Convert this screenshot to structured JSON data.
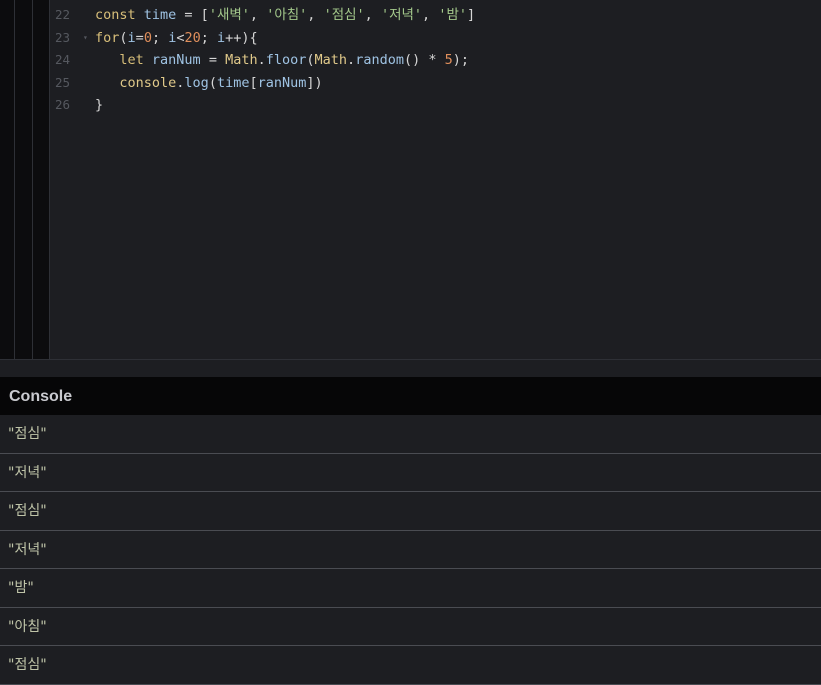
{
  "editor": {
    "lines": [
      {
        "number": "22",
        "fold": "",
        "tokens": [
          {
            "t": "const",
            "c": "kw"
          },
          {
            "t": " ",
            "c": "punct"
          },
          {
            "t": "time",
            "c": "var"
          },
          {
            "t": " = [",
            "c": "punct"
          },
          {
            "t": "'새벽'",
            "c": "str"
          },
          {
            "t": ", ",
            "c": "punct"
          },
          {
            "t": "'아침'",
            "c": "str"
          },
          {
            "t": ", ",
            "c": "punct"
          },
          {
            "t": "'점심'",
            "c": "str"
          },
          {
            "t": ", ",
            "c": "punct"
          },
          {
            "t": "'저녁'",
            "c": "str"
          },
          {
            "t": ", ",
            "c": "punct"
          },
          {
            "t": "'밤'",
            "c": "str"
          },
          {
            "t": "]",
            "c": "punct"
          }
        ]
      },
      {
        "number": "23",
        "fold": "▾",
        "tokens": [
          {
            "t": "for",
            "c": "kw"
          },
          {
            "t": "(",
            "c": "punct"
          },
          {
            "t": "i",
            "c": "var"
          },
          {
            "t": "=",
            "c": "punct"
          },
          {
            "t": "0",
            "c": "num"
          },
          {
            "t": "; ",
            "c": "punct"
          },
          {
            "t": "i",
            "c": "var"
          },
          {
            "t": "<",
            "c": "punct"
          },
          {
            "t": "20",
            "c": "num"
          },
          {
            "t": "; ",
            "c": "punct"
          },
          {
            "t": "i",
            "c": "var"
          },
          {
            "t": "++){",
            "c": "punct"
          }
        ]
      },
      {
        "number": "24",
        "fold": "",
        "tokens": [
          {
            "t": "   let",
            "c": "kw"
          },
          {
            "t": " ",
            "c": "punct"
          },
          {
            "t": "ranNum",
            "c": "var"
          },
          {
            "t": " = ",
            "c": "punct"
          },
          {
            "t": "Math",
            "c": "obj"
          },
          {
            "t": ".",
            "c": "punct"
          },
          {
            "t": "floor",
            "c": "fn"
          },
          {
            "t": "(",
            "c": "punct"
          },
          {
            "t": "Math",
            "c": "obj"
          },
          {
            "t": ".",
            "c": "punct"
          },
          {
            "t": "random",
            "c": "fn"
          },
          {
            "t": "() * ",
            "c": "punct"
          },
          {
            "t": "5",
            "c": "num"
          },
          {
            "t": ");",
            "c": "punct"
          }
        ]
      },
      {
        "number": "25",
        "fold": "",
        "tokens": [
          {
            "t": "   console",
            "c": "obj"
          },
          {
            "t": ".",
            "c": "punct"
          },
          {
            "t": "log",
            "c": "fn"
          },
          {
            "t": "(",
            "c": "punct"
          },
          {
            "t": "time",
            "c": "var"
          },
          {
            "t": "[",
            "c": "punct"
          },
          {
            "t": "ranNum",
            "c": "var"
          },
          {
            "t": "])",
            "c": "punct"
          }
        ]
      },
      {
        "number": "26",
        "fold": "",
        "tokens": [
          {
            "t": "}",
            "c": "punct"
          }
        ]
      }
    ]
  },
  "console": {
    "title": "Console",
    "entries": [
      "\"점심\"",
      "\"저녁\"",
      "\"점심\"",
      "\"저녁\"",
      "\"밤\"",
      "\"아침\"",
      "\"점심\""
    ]
  },
  "colors": {
    "background": "#1d1e22",
    "console_header": "#060607",
    "keyword": "#d8bf7a",
    "string": "#a3c88b",
    "number": "#e08f5c",
    "identifier": "#9fc3e3"
  }
}
